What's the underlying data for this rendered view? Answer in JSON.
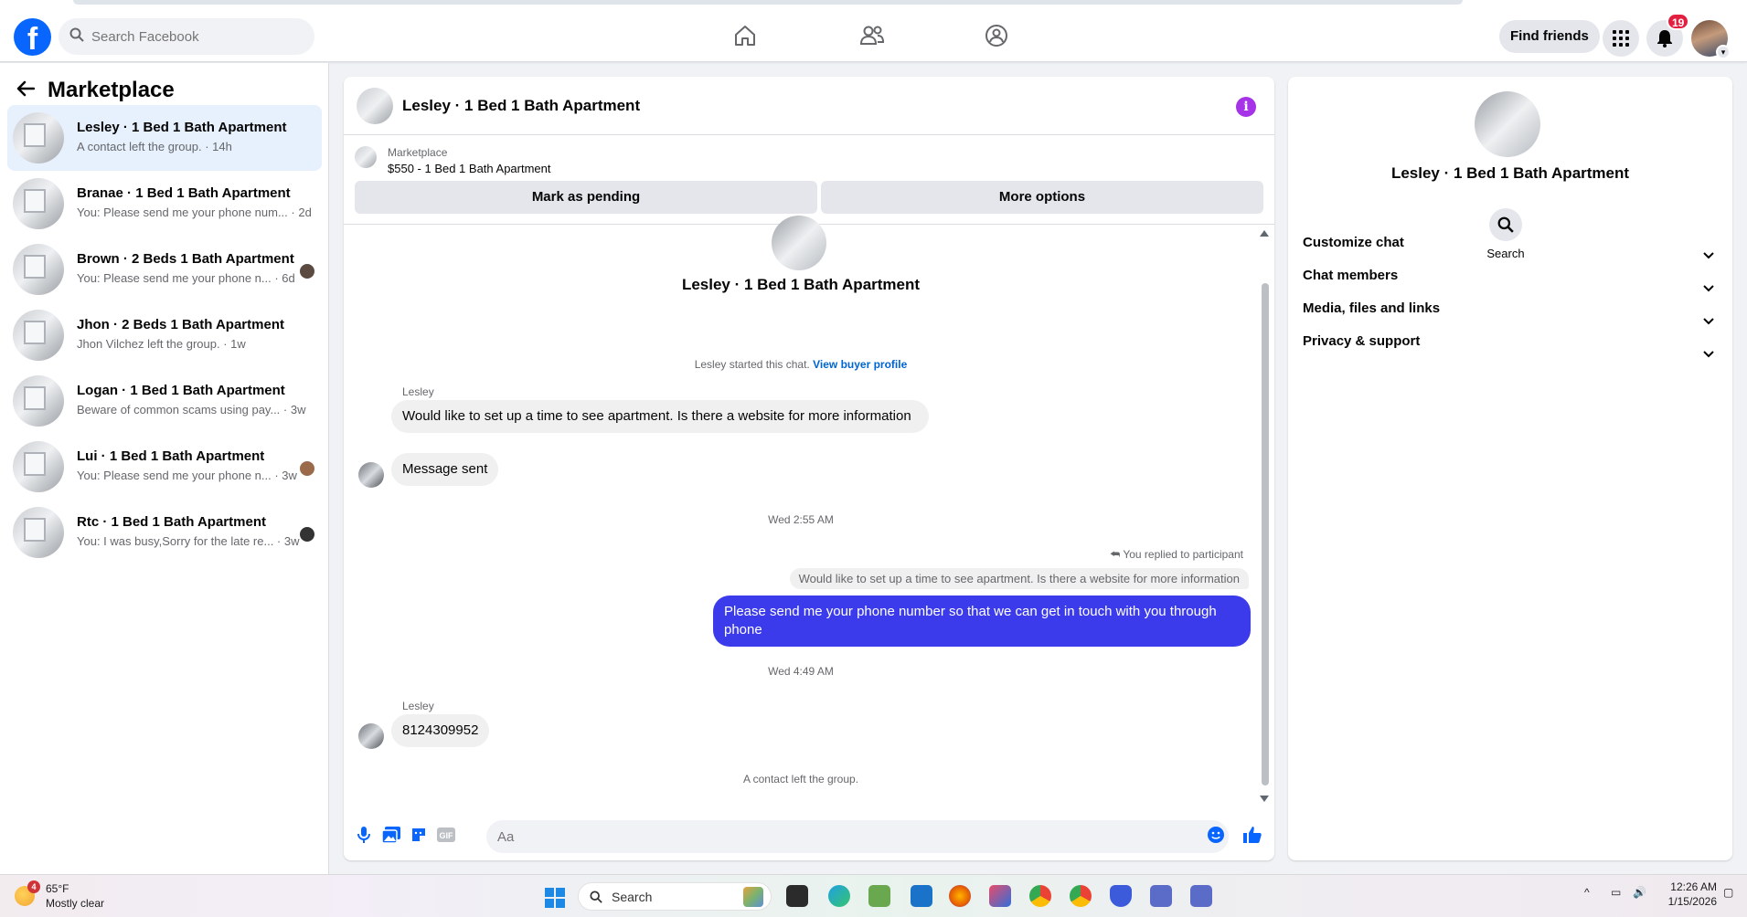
{
  "nav": {
    "search_placeholder": "Search Facebook",
    "find_friends": "Find friends",
    "notification_count": "19"
  },
  "left": {
    "title": "Marketplace",
    "conversations": [
      {
        "name": "Lesley · 1 Bed 1 Bath Apartment",
        "preview": "A contact left the group. · 14h",
        "active": true
      },
      {
        "name": "Branae · 1 Bed 1 Bath Apartment",
        "preview": "You: Please send me your phone num... · 2d"
      },
      {
        "name": "Brown · 2 Beds 1 Bath Apartment",
        "preview": "You: Please send me your phone n... · 6d"
      },
      {
        "name": "Jhon · 2 Beds 1 Bath Apartment",
        "preview": "Jhon Vilchez left the group. · 1w"
      },
      {
        "name": "Logan · 1 Bed 1 Bath Apartment",
        "preview": "Beware of common scams using pay... · 3w"
      },
      {
        "name": "Lui · 1 Bed 1 Bath Apartment",
        "preview": "You: Please send me your phone n... · 3w"
      },
      {
        "name": "Rtc · 1 Bed 1 Bath Apartment",
        "preview": "You: I was busy,Sorry for the late re... · 3w"
      }
    ]
  },
  "chat": {
    "header_name": "Lesley · 1 Bed 1 Bath Apartment",
    "marketplace_caption": "Marketplace",
    "listing": "$550 - 1 Bed 1 Bath Apartment",
    "mark_pending": "Mark as pending",
    "more_options": "More options",
    "center_title": "Lesley · 1 Bed 1 Bath Apartment",
    "started_text": "Lesley started this chat.",
    "view_buyer_profile": "View buyer profile",
    "sender_1": "Lesley",
    "msg_1": "Would like to set up a time to see apartment.  Is there a website for more information",
    "msg_2": "Message sent",
    "time_1": "Wed 2:55 AM",
    "replied_label": "You replied to participant",
    "quoted_msg": "Would like to set up a time to see apartment.  Is there a website for more information",
    "my_msg": "Please send me your phone  number so that we can get in touch with you through phone",
    "time_2": "Wed 4:49 AM",
    "sender_2": "Lesley",
    "msg_3": "8124309952",
    "left_group": "A contact left the group.",
    "composer_placeholder": "Aa"
  },
  "right": {
    "name": "Lesley · 1 Bed 1 Bath Apartment",
    "search_label": "Search",
    "sections": [
      "Customize chat",
      "Chat members",
      "Media, files and links",
      "Privacy & support"
    ]
  },
  "taskbar": {
    "weather_badge": "4",
    "temp": "65°F",
    "condition": "Mostly clear",
    "search_label": "Search",
    "time": "12:26 AM",
    "date": "1/15/2026"
  },
  "colors": {
    "brand": "#0866ff",
    "my_bubble": "#3b3beb",
    "active_item": "#e7f0fd"
  }
}
